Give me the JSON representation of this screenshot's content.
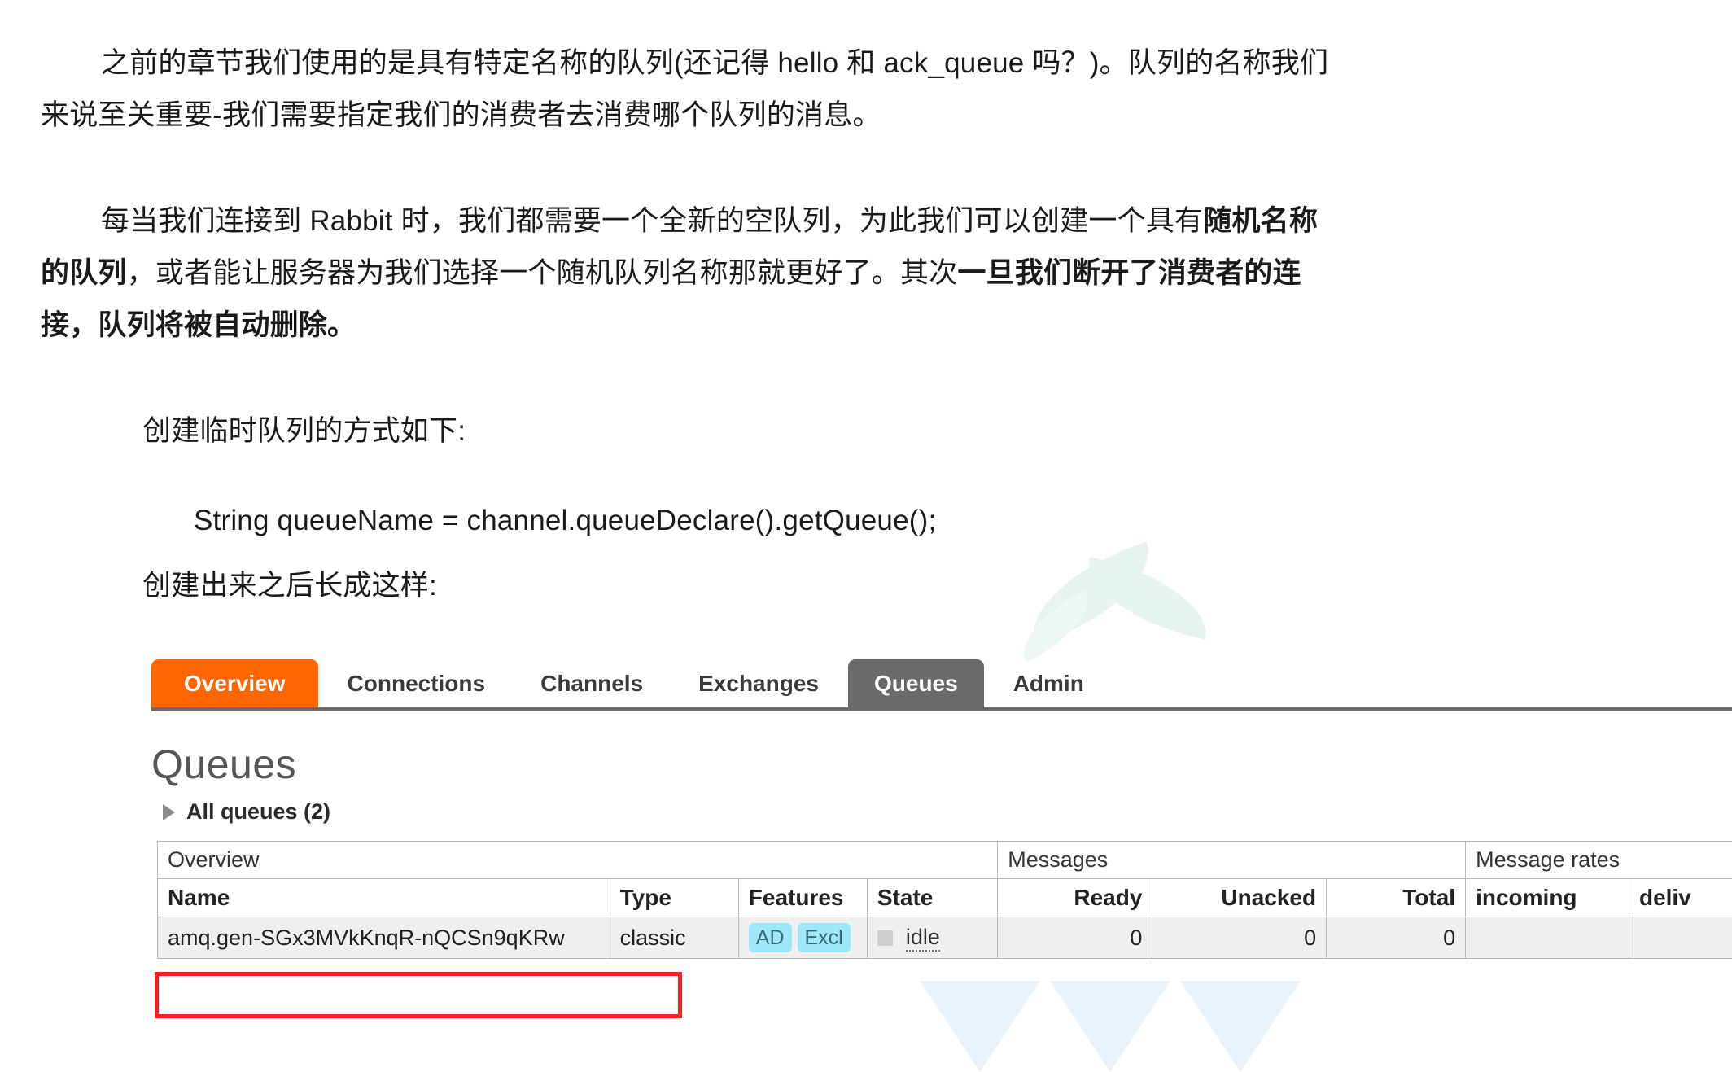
{
  "document": {
    "paragraph_1": {
      "line_1": "之前的章节我们使用的是具有特定名称的队列(还记得 hello 和 ack_queue 吗？)。队列的名称我们",
      "line_2": "来说至关重要-我们需要指定我们的消费者去消费哪个队列的消息。"
    },
    "paragraph_2": {
      "line_1_a": "每当我们连接到 Rabbit 时，我们都需要一个全新的空队列，为此我们可以创建一个具有",
      "line_1_b": "随机名称",
      "line_2_a": "的队列",
      "line_2_b": "，或者能让服务器为我们选择一个随机队列名称那就更好了。其次",
      "line_2_c": "一旦我们断开了消费者的连",
      "line_3": "接，队列将被自动删除。"
    },
    "paragraph_3": "创建临时队列的方式如下:",
    "code_line": "String queueName = channel.queueDeclare().getQueue();",
    "paragraph_4": "创建出来之后长成这样:"
  },
  "rabbitmq": {
    "tabs": [
      {
        "label": "Overview",
        "state": "active-orange"
      },
      {
        "label": "Connections",
        "state": "normal"
      },
      {
        "label": "Channels",
        "state": "normal"
      },
      {
        "label": "Exchanges",
        "state": "normal"
      },
      {
        "label": "Queues",
        "state": "active-grey"
      },
      {
        "label": "Admin",
        "state": "normal"
      }
    ],
    "page_title": "Queues",
    "all_queues_label": "All queues (2)",
    "table": {
      "group_headers": {
        "overview": "Overview",
        "messages": "Messages",
        "message_rates": "Message rates"
      },
      "columns": {
        "name": "Name",
        "type": "Type",
        "features": "Features",
        "state": "State",
        "ready": "Ready",
        "unacked": "Unacked",
        "total": "Total",
        "incoming": "incoming",
        "deliver": "deliv"
      },
      "rows": [
        {
          "name": "amq.gen-SGx3MVkKnqR-nQCSn9qKRw",
          "type": "classic",
          "features": [
            "AD",
            "Excl"
          ],
          "state": "idle",
          "ready": "0",
          "unacked": "0",
          "total": "0",
          "incoming": "",
          "deliver": ""
        }
      ]
    },
    "colors": {
      "active_tab": "#ff6600",
      "selected_tab": "#6a6a6a",
      "feature_badge": "#9ee8fb",
      "highlight_box": "#ee2222"
    }
  }
}
